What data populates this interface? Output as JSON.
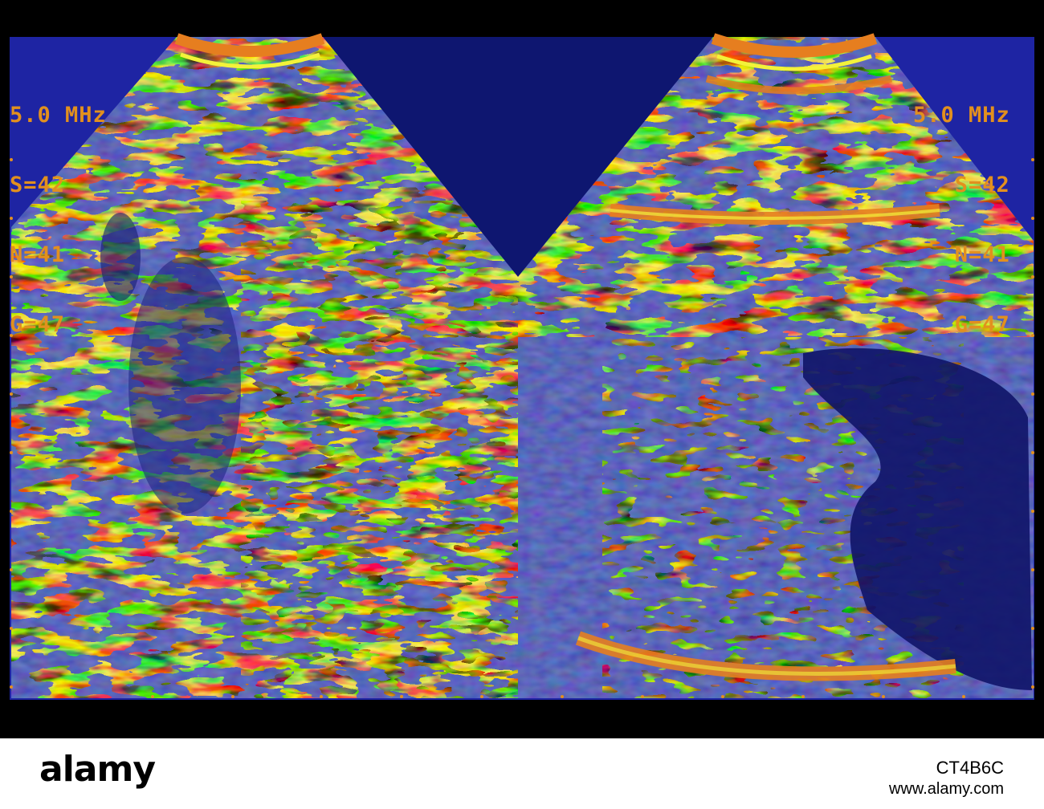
{
  "image": {
    "description_colors": {
      "background": "#000000",
      "field_blue": "#1e24a3",
      "deep_blue": "#0c1068",
      "speckle_blue": "#3a4aa0",
      "speckle_yellow": "#f3f23a",
      "speckle_orange": "#e8821f",
      "speckle_dark": "#3a1206",
      "readout_orange": "#e2901e"
    }
  },
  "readout_left": {
    "freq": "5.0 MHz",
    "s": "S=42",
    "n": "N=41",
    "g": "G=47"
  },
  "readout_right": {
    "freq": "5.0 MHz",
    "s": "S=42",
    "n": "N=41",
    "g": "G=47"
  },
  "watermark": {
    "logo": "alamy",
    "image_id": "CT4B6C",
    "url": "www.alamy.com"
  }
}
